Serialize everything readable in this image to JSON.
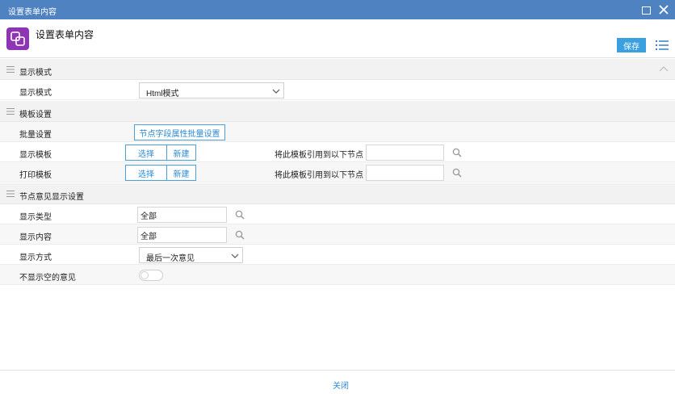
{
  "window": {
    "title": "设置表单内容"
  },
  "header": {
    "title": "设置表单内容",
    "save_label": "保存"
  },
  "sections": {
    "display_mode": {
      "title": "显示模式",
      "rows": {
        "mode": {
          "label": "显示模式",
          "value": "Html模式"
        }
      }
    },
    "template": {
      "title": "模板设置",
      "rows": {
        "batch": {
          "label": "批量设置",
          "button": "节点字段属性批量设置"
        },
        "display_template": {
          "label": "显示模板",
          "select": "选择",
          "new": "新建",
          "apply_label": "将此模板引用到以下节点",
          "nodes_value": ""
        },
        "print_template": {
          "label": "打印模板",
          "select": "选择",
          "new": "新建",
          "apply_label": "将此模板引用到以下节点",
          "nodes_value": ""
        }
      }
    },
    "opinion": {
      "title": "节点意见显示设置",
      "rows": {
        "display_type": {
          "label": "显示类型",
          "value": "全部"
        },
        "display_content": {
          "label": "显示内容",
          "value": "全部"
        },
        "display_method": {
          "label": "显示方式",
          "value": "最后一次意见"
        },
        "hide_empty": {
          "label": "不显示空的意见",
          "enabled": false
        }
      }
    }
  },
  "footer": {
    "close_label": "关闭"
  },
  "colors": {
    "titlebar": "#4f82c0",
    "accent": "#3ba0e0",
    "app_icon": "#8e35b4"
  },
  "icons": [
    "app-logo-icon",
    "maximize-icon",
    "close-icon",
    "list-menu-icon",
    "drag-handle-icon",
    "chevron-up-icon",
    "chevron-down-icon",
    "search-icon"
  ]
}
